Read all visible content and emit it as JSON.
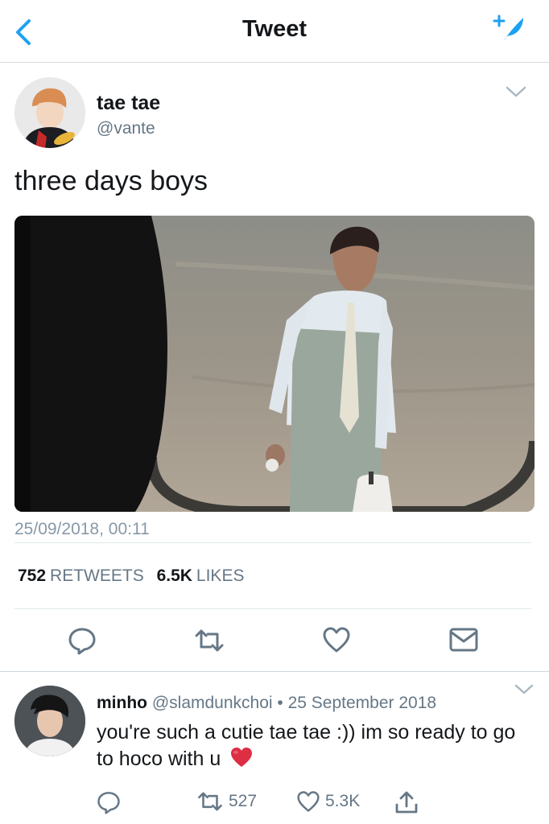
{
  "navbar": {
    "title": "Tweet"
  },
  "tweet": {
    "author_name": "tae tae",
    "author_handle": "@vante",
    "text": "three days boys",
    "timestamp": "25/09/2018, 00:11",
    "retweets_count": "752",
    "retweets_label": "RETWEETS",
    "likes_count": "6.5K",
    "likes_label": "LIKES"
  },
  "reply": {
    "author_name": "minho",
    "author_handle": "@slamdunkchoi",
    "separator": "•",
    "date": "25 September 2018",
    "text": "you're such a cutie tae tae :)) im so ready to go to hoco with u",
    "retweet_count": "527",
    "like_count": "5.3K"
  },
  "colors": {
    "accent": "#1da1f2",
    "icon_gray": "#657786",
    "heart": "#e0245e"
  },
  "icons": [
    "chevron-left-icon",
    "compose-tweet-icon",
    "chevron-down-icon",
    "reply-icon",
    "retweet-icon",
    "like-icon",
    "direct-message-icon",
    "share-icon",
    "red-heart-emoji"
  ]
}
